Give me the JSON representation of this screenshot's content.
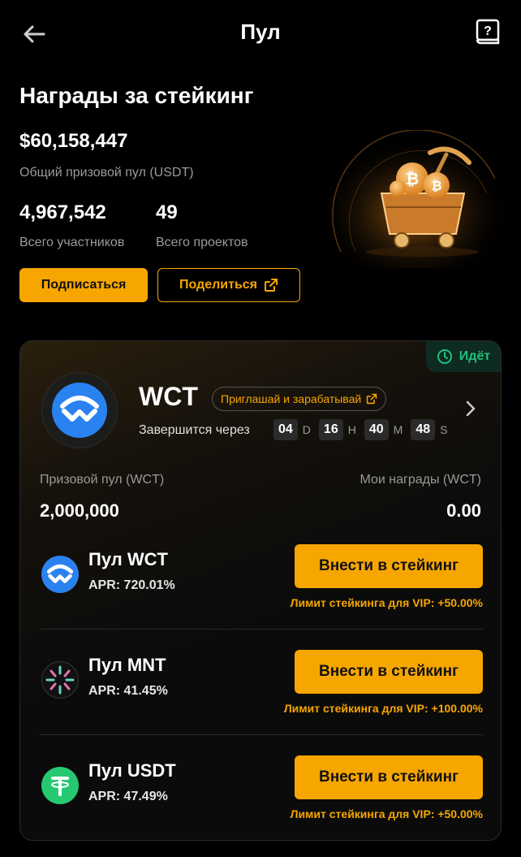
{
  "header": {
    "title": "Пул"
  },
  "hero": {
    "title": "Награды за стейкинг",
    "total_pool": "$60,158,447",
    "total_pool_label": "Общий призовой пул (USDT)",
    "participants": "4,967,542",
    "participants_label": "Всего участников",
    "projects": "49",
    "projects_label": "Всего проектов",
    "subscribe_label": "Подписаться",
    "share_label": "Поделиться"
  },
  "card": {
    "status": "Идёт",
    "coin": "WCT",
    "invite_label": "Приглашай и зарабатывай",
    "ends_label": "Завершится через",
    "timer": {
      "d": "04",
      "d_unit": "D",
      "h": "16",
      "h_unit": "H",
      "m": "40",
      "m_unit": "M",
      "s": "48",
      "s_unit": "S"
    },
    "prize_pool_label": "Призовой пул (WCT)",
    "prize_pool_value": "2,000,000",
    "my_rewards_label": "Мои награды (WCT)",
    "my_rewards_value": "0.00",
    "pools": [
      {
        "name": "Пул WCT",
        "apr": "APR: 720.01%",
        "button": "Внести в стейкинг",
        "vip": "Лимит стейкинга для VIP: +50.00%",
        "icon": "wct-icon"
      },
      {
        "name": "Пул MNT",
        "apr": "APR: 41.45%",
        "button": "Внести в стейкинг",
        "vip": "Лимит стейкинга для VIP: +100.00%",
        "icon": "mnt-icon"
      },
      {
        "name": "Пул USDT",
        "apr": "APR: 47.49%",
        "button": "Внести в стейкинг",
        "vip": "Лимит стейкинга для VIP: +50.00%",
        "icon": "usdt-icon"
      }
    ]
  },
  "colors": {
    "accent": "#f7a600",
    "status_green": "#21c07a",
    "wct_blue": "#2a82f0",
    "usdt_green": "#26c971"
  }
}
